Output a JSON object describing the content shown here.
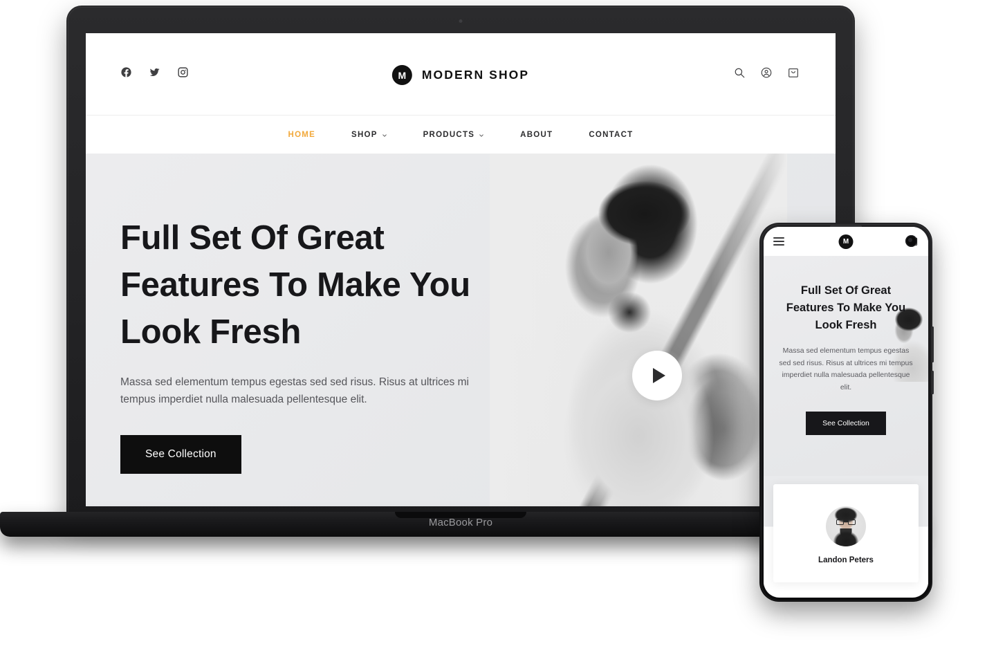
{
  "device": {
    "laptop_label": "MacBook Pro"
  },
  "site": {
    "brand": {
      "mark": "M",
      "name": "MODERN SHOP"
    },
    "social": [
      {
        "name": "facebook-icon",
        "label": "Facebook"
      },
      {
        "name": "twitter-icon",
        "label": "Twitter"
      },
      {
        "name": "instagram-icon",
        "label": "Instagram"
      }
    ],
    "utilities": [
      {
        "name": "search-icon",
        "label": "Search"
      },
      {
        "name": "account-icon",
        "label": "Account"
      },
      {
        "name": "cart-icon",
        "label": "Cart"
      }
    ],
    "nav": [
      {
        "label": "HOME",
        "active": true,
        "caret": false
      },
      {
        "label": "SHOP",
        "active": false,
        "caret": true
      },
      {
        "label": "PRODUCTS",
        "active": false,
        "caret": true
      },
      {
        "label": "ABOUT",
        "active": false,
        "caret": false
      },
      {
        "label": "CONTACT",
        "active": false,
        "caret": false
      }
    ],
    "hero": {
      "heading": "Full Set Of Great Features To Make You Look Fresh",
      "paragraph": "Massa sed elementum tempus egestas sed sed risus. Risus at ultrices mi tempus imperdiet nulla malesuada pellentesque elit.",
      "cta_label": "See Collection",
      "play_label": "Play video"
    }
  },
  "mobile": {
    "brand_mark": "M",
    "menu_label": "Menu",
    "cart_label": "Cart",
    "hero": {
      "heading": "Full Set Of Great Features To Make You Look Fresh",
      "paragraph": "Massa sed elementum tempus egestas sed sed risus. Risus at ultrices mi tempus imperdiet nulla malesuada pellentesque elit.",
      "cta_label": "See Collection"
    },
    "testimonial": {
      "name": "Landon Peters",
      "avatar_label": "Landon Peters avatar"
    }
  },
  "colors": {
    "accent": "#f2a93b",
    "dark": "#111111",
    "hero_bg": "#e9eaec",
    "device_frame": "#232325",
    "text": "#17171a",
    "muted": "#55555a"
  }
}
